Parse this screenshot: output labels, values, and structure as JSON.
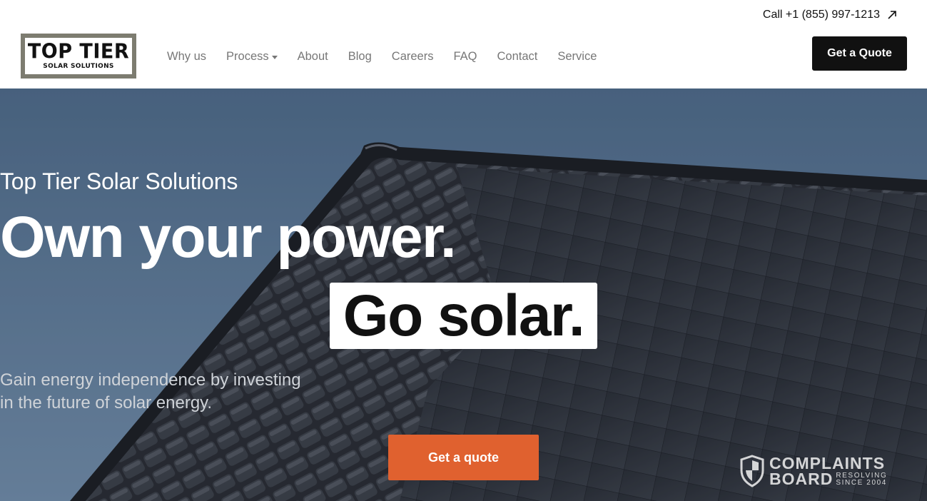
{
  "header": {
    "call_label": "Call +1 (855) 997-1213",
    "logo": {
      "main": "TOP TIER",
      "sub": "SOLAR SOLUTIONS"
    },
    "nav": [
      {
        "label": "Why us",
        "has_dropdown": false
      },
      {
        "label": "Process",
        "has_dropdown": true
      },
      {
        "label": "About",
        "has_dropdown": false
      },
      {
        "label": "Blog",
        "has_dropdown": false
      },
      {
        "label": "Careers",
        "has_dropdown": false
      },
      {
        "label": "FAQ",
        "has_dropdown": false
      },
      {
        "label": "Contact",
        "has_dropdown": false
      },
      {
        "label": "Service",
        "has_dropdown": false
      }
    ],
    "quote_button": "Get a Quote"
  },
  "hero": {
    "kicker": "Top Tier Solar Solutions",
    "headline": "Own your power.",
    "highlight": "Go solar.",
    "subtitle_line1": "Gain energy independence by investing",
    "subtitle_line2": "in the future of solar energy.",
    "cta": "Get a quote"
  },
  "badge": {
    "line1": "COMPLAINTS",
    "line2": "BOARD",
    "tag1": "RESOLVING",
    "tag2": "SINCE 2004"
  },
  "colors": {
    "accent": "#e0612f",
    "dark": "#111111",
    "logo_frame": "#7d7c70",
    "nav_text": "#777777"
  }
}
